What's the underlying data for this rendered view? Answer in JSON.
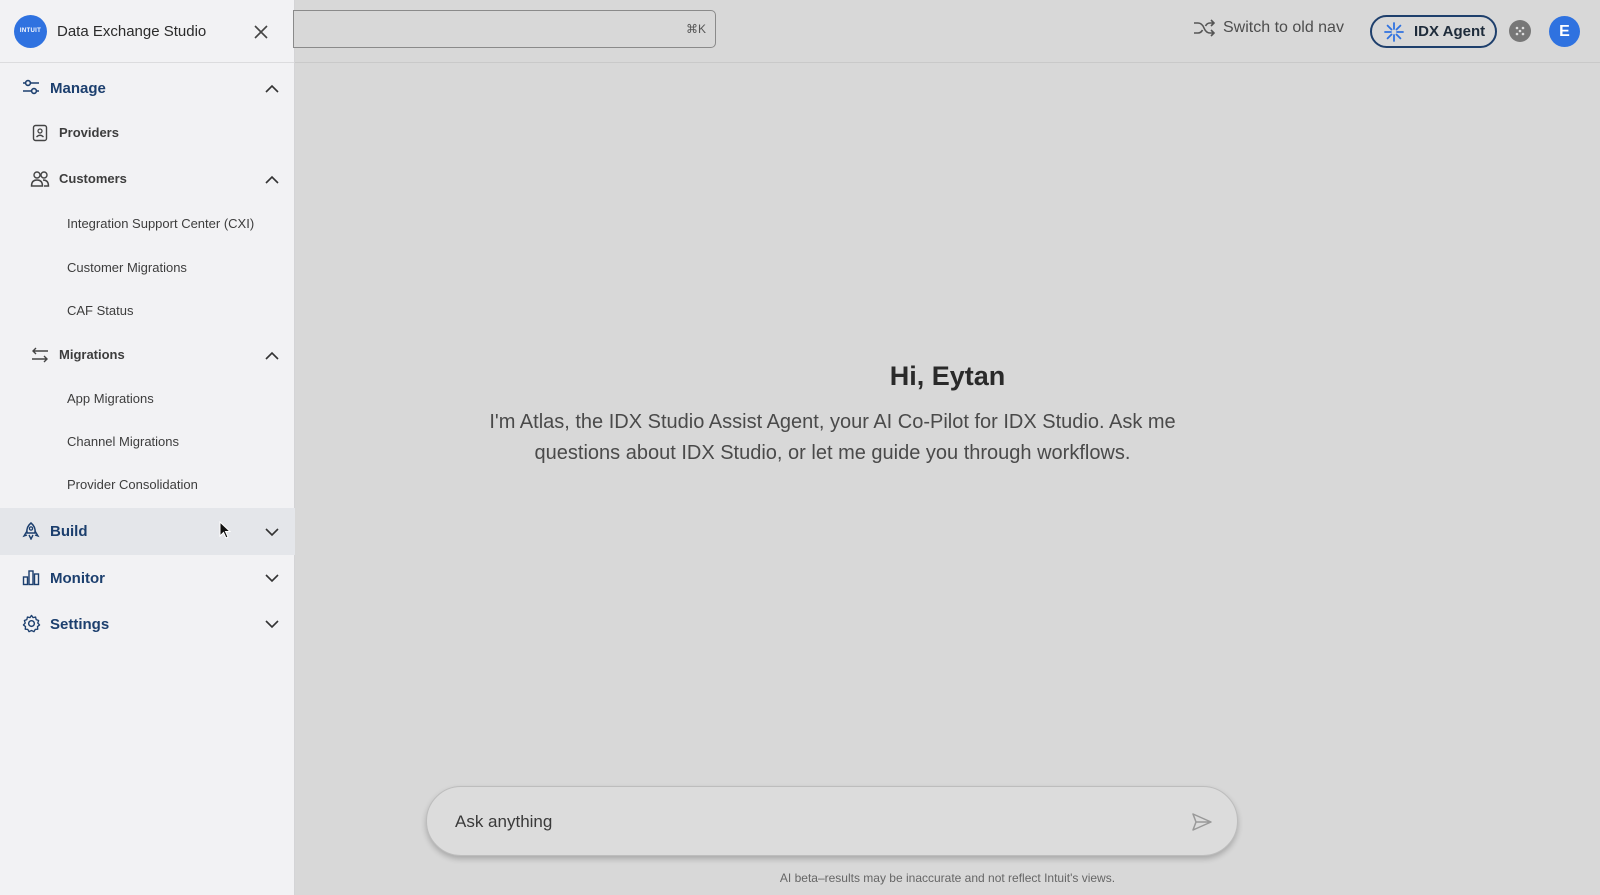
{
  "app": {
    "logo_text": "INTUIT",
    "title": "Data Exchange Studio"
  },
  "sidebar": {
    "manage": {
      "label": "Manage",
      "items": [
        {
          "label": "Providers"
        },
        {
          "label": "Customers",
          "children": [
            "Integration Support Center (CXI)",
            "Customer Migrations",
            "CAF Status"
          ]
        },
        {
          "label": "Migrations",
          "children": [
            "App Migrations",
            "Channel Migrations",
            "Provider Consolidation"
          ]
        }
      ]
    },
    "build": {
      "label": "Build"
    },
    "monitor": {
      "label": "Monitor"
    },
    "settings": {
      "label": "Settings"
    }
  },
  "topbar": {
    "search_shortcut": "⌘K",
    "switch_nav_label": "Switch to old nav",
    "agent_label": "IDX Agent",
    "avatar_initial": "E"
  },
  "main": {
    "greeting": "Hi, Eytan",
    "intro": "I'm Atlas, the IDX Studio Assist Agent, your AI Co-Pilot for IDX Studio. Ask me questions about IDX Studio, or let me guide you through workflows.",
    "ask_placeholder": "Ask anything",
    "disclaimer": "AI beta–results may be inaccurate and not reflect Intuit's views."
  },
  "colors": {
    "brand_blue": "#2f72e0",
    "nav_text": "#1c3f6e",
    "agent_border": "#1e3f6c"
  }
}
